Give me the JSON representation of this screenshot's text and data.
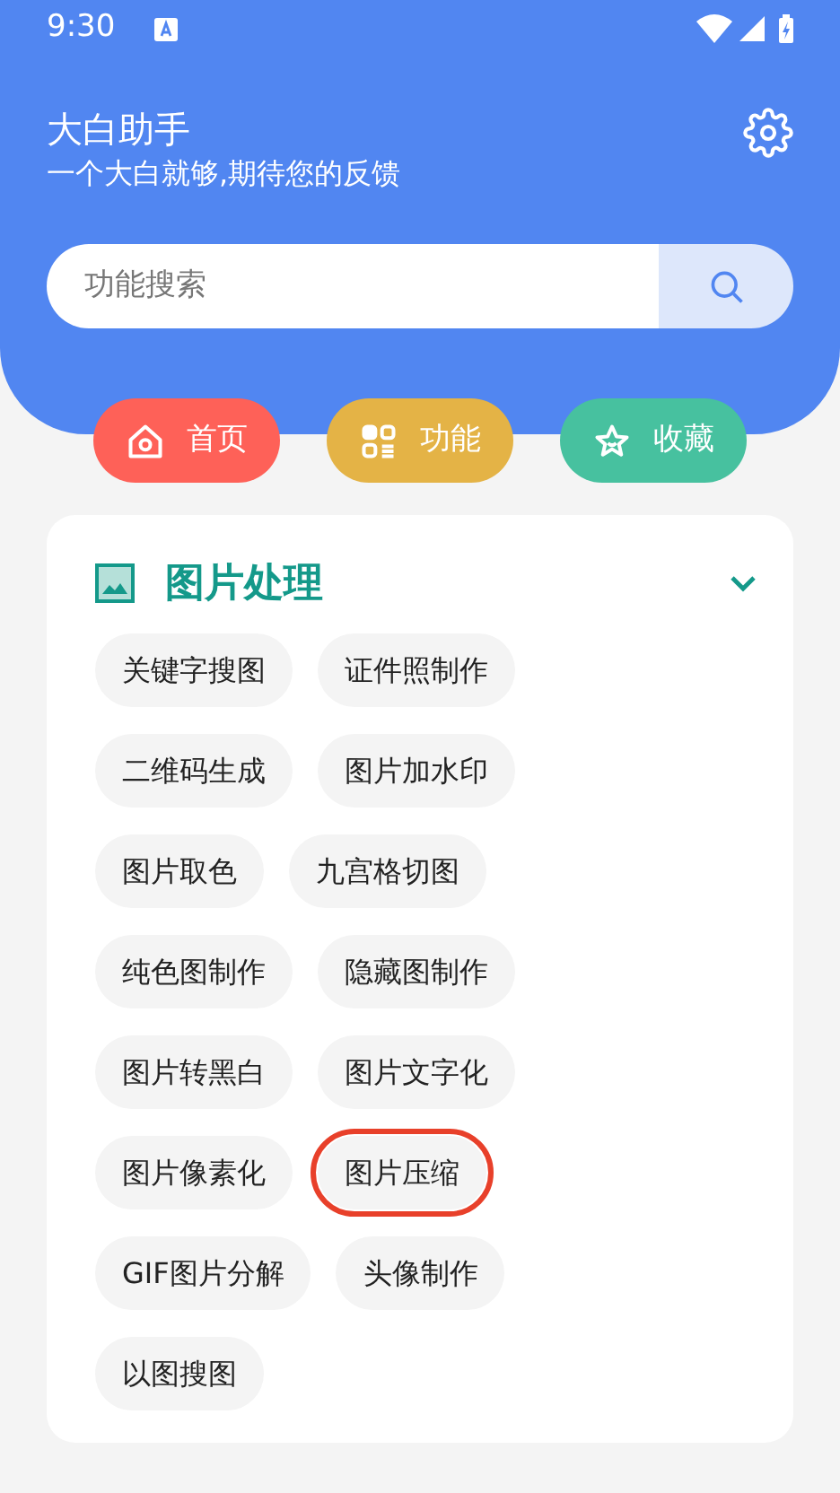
{
  "status_bar": {
    "time": "9:30"
  },
  "header": {
    "title": "大白助手",
    "subtitle": "一个大白就够,期待您的反馈"
  },
  "search": {
    "placeholder": "功能搜索"
  },
  "nav": [
    {
      "kind": "home",
      "label": "首页",
      "color": "#fe6158"
    },
    {
      "kind": "apps",
      "label": "功能",
      "color": "#e4b346"
    },
    {
      "kind": "star",
      "label": "收藏",
      "color": "#47c19f"
    }
  ],
  "section": {
    "title": "图片处理",
    "expanded": true,
    "rows": [
      [
        {
          "label": "关键字搜图",
          "highlighted": false
        },
        {
          "label": "证件照制作",
          "highlighted": false
        }
      ],
      [
        {
          "label": "二维码生成",
          "highlighted": false
        },
        {
          "label": "图片加水印",
          "highlighted": false
        }
      ],
      [
        {
          "label": "图片取色",
          "highlighted": false
        },
        {
          "label": "九宫格切图",
          "highlighted": false
        }
      ],
      [
        {
          "label": "纯色图制作",
          "highlighted": false
        },
        {
          "label": "隐藏图制作",
          "highlighted": false
        }
      ],
      [
        {
          "label": "图片转黑白",
          "highlighted": false
        },
        {
          "label": "图片文字化",
          "highlighted": false
        }
      ],
      [
        {
          "label": "图片像素化",
          "highlighted": false
        },
        {
          "label": "图片压缩",
          "highlighted": true
        }
      ],
      [
        {
          "label": "GIF图片分解",
          "highlighted": false
        },
        {
          "label": "头像制作",
          "highlighted": false
        }
      ],
      [
        {
          "label": "以图搜图",
          "highlighted": false
        }
      ]
    ]
  }
}
